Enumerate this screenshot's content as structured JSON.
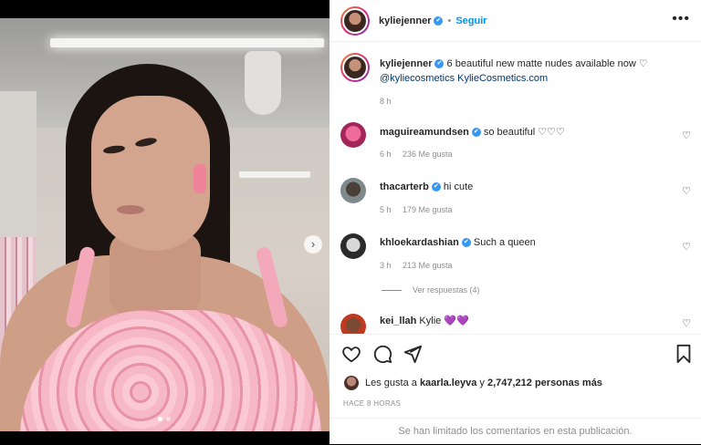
{
  "header": {
    "username": "kyliejenner",
    "follow_label": "Seguir",
    "separator": "•",
    "more_label": "•••"
  },
  "caption": {
    "username": "kyliejenner",
    "text": "6 beautiful new matte nudes available now ♡",
    "mention": "@kyliecosmetics",
    "extra": "KylieCosmetics.com",
    "time": "8 h"
  },
  "comments": [
    {
      "username": "maguireamundsen",
      "verified": true,
      "text": "so beautiful ♡♡♡",
      "time": "6 h",
      "likes": "236 Me gusta"
    },
    {
      "username": "thacarterb",
      "verified": true,
      "text": "hi cute",
      "time": "5 h",
      "likes": "179 Me gusta"
    },
    {
      "username": "khloekardashian",
      "verified": true,
      "text": "Such a queen",
      "time": "3 h",
      "likes": "213 Me gusta"
    },
    {
      "username": "kei_llah",
      "verified": false,
      "text": "Kylie 💜💜"
    }
  ],
  "view_replies": "Ver respuestas (4)",
  "likes": {
    "prefix": "Les gusta a",
    "user": "kaarla.leyva",
    "middle": "y",
    "count": "2,747,212 personas más"
  },
  "time_ago": "HACE 8 HORAS",
  "comments_limited": "Se han limitado los comentarios en esta publicación.",
  "carousel": {
    "next_label": "›",
    "total": 2,
    "current": 1
  },
  "icons": {
    "verified": "✔",
    "heart": "♡"
  },
  "colors": {
    "accent": "#0095f6",
    "verified": "#3897f0",
    "text": "#262626",
    "muted": "#8e8e8e"
  }
}
